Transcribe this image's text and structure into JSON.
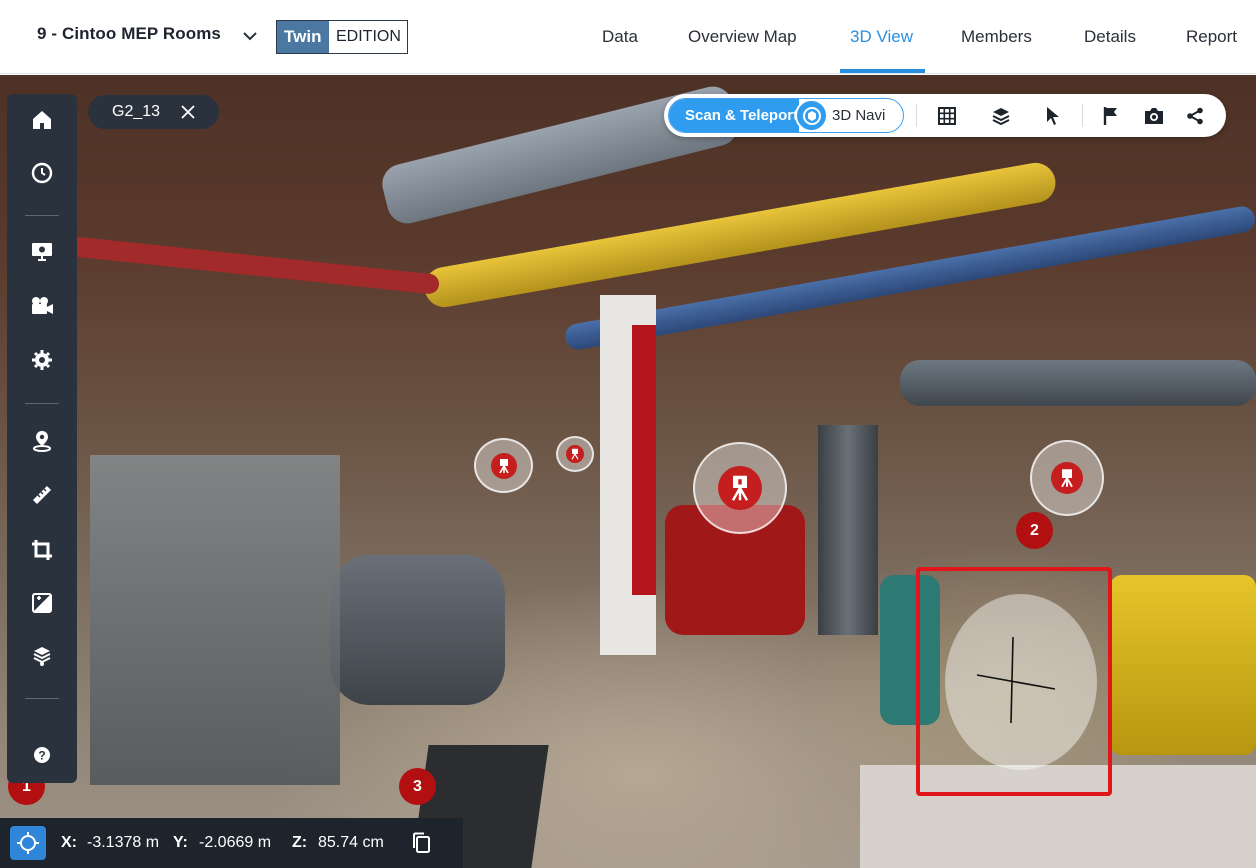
{
  "header": {
    "project_name": "9 - Cintoo MEP Rooms",
    "edition_twin": "Twin",
    "edition_label": "EDITION",
    "nav": [
      {
        "label": "Data",
        "active": false
      },
      {
        "label": "Overview Map",
        "active": false
      },
      {
        "label": "3D View",
        "active": true
      },
      {
        "label": "Members",
        "active": false
      },
      {
        "label": "Details",
        "active": false
      },
      {
        "label": "Report",
        "active": false
      }
    ]
  },
  "sidebar": {
    "items": [
      "home-icon",
      "clock-icon",
      "presentation-icon",
      "video-camera-icon",
      "gear-icon",
      "location-pin-icon",
      "ruler-icon",
      "crop-icon",
      "compare-icon",
      "model-icon",
      "help-icon"
    ]
  },
  "scan_tab": {
    "label": "G2_13"
  },
  "toolbar": {
    "mode_active": "Scan & Teleport",
    "mode_other": "3D Navi",
    "tools": [
      "grid-icon",
      "layers-icon",
      "pointer-icon",
      "flag-icon",
      "camera-icon",
      "share-icon"
    ]
  },
  "badges": [
    "1",
    "2",
    "3"
  ],
  "coordinates": {
    "x_label": "X:",
    "x_value": "-3.1378 m",
    "y_label": "Y:",
    "y_value": "-2.0669 m",
    "z_label": "Z:",
    "z_value": "85.74 cm"
  },
  "colors": {
    "accent": "#2a8fe0",
    "highlight": "#e0161b",
    "badge": "#b21010",
    "sidebar": "#2a323d"
  }
}
